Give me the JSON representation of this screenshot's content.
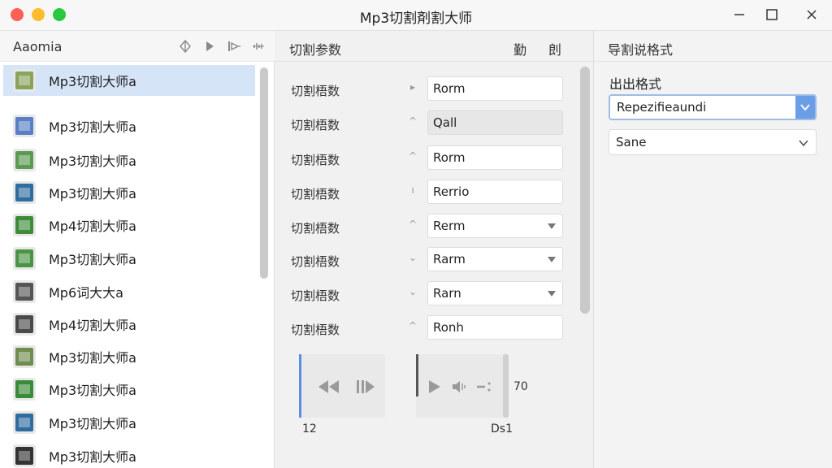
{
  "window": {
    "title": "Mp3切割剤割大师"
  },
  "sidebar": {
    "title": "Aaomia",
    "tools": [
      "diamond-icon",
      "play-icon",
      "skip-icon",
      "waveform-icon"
    ],
    "items": [
      {
        "label": "Mp3切割大师a",
        "icon": "grid-file-icon",
        "color": "#8aa35c",
        "selected": true
      },
      {
        "label": "Mp3切割大师a",
        "icon": "info-file-icon",
        "color": "#5a7fc4"
      },
      {
        "label": "Mp3切割大师a",
        "icon": "lines-file-icon",
        "color": "#5b9a52"
      },
      {
        "label": "Mp3切割大师a",
        "icon": "forward-file-icon",
        "color": "#2f6d9e"
      },
      {
        "label": "Mp4切割大师a",
        "icon": "green-video-icon",
        "color": "#3e8c3a"
      },
      {
        "label": "Mp3切割大师a",
        "icon": "green-screen-icon",
        "color": "#4a9448"
      },
      {
        "label": "Mp6词大大a",
        "icon": "dark-file-icon",
        "color": "#555555"
      },
      {
        "label": "Mp4切割大师a",
        "icon": "close-file-icon",
        "color": "#4a4a4a"
      },
      {
        "label": "Mp3切割大师a",
        "icon": "grid-file-icon",
        "color": "#6f8d4f"
      },
      {
        "label": "Mp3切割大师a",
        "icon": "play-file-icon",
        "color": "#3b8a39"
      },
      {
        "label": "Mp3切割大师a",
        "icon": "blue-file-icon",
        "color": "#2f6d9e"
      },
      {
        "label": "Mp3切割大师a",
        "icon": "stripe-file-icon",
        "color": "#333333"
      }
    ]
  },
  "middle": {
    "title": "切割参数",
    "header_2": "勤",
    "header_3": "剆",
    "params": [
      {
        "label": "切割梧数",
        "arrow": "▸",
        "value": "Rorm",
        "dropdown": false,
        "disabled": false
      },
      {
        "label": "切割梧数",
        "arrow": "^",
        "value": "Qall",
        "dropdown": false,
        "disabled": true
      },
      {
        "label": "切割梧数",
        "arrow": "^",
        "value": "Rorm",
        "dropdown": false,
        "disabled": false
      },
      {
        "label": "切割梧数",
        "arrow": "ı",
        "value": "Rerrio",
        "dropdown": false,
        "disabled": false
      },
      {
        "label": "切割梧数",
        "arrow": "^",
        "value": "Rerm",
        "dropdown": true,
        "disabled": false
      },
      {
        "label": "切割梧数",
        "arrow": "⌄",
        "value": "Rarm",
        "dropdown": true,
        "disabled": false
      },
      {
        "label": "切割梧数",
        "arrow": "⌄",
        "value": "Rarn",
        "dropdown": true,
        "disabled": false
      },
      {
        "label": "切割梧数",
        "arrow": "^",
        "value": "Ronh",
        "dropdown": false,
        "disabled": false
      }
    ],
    "player": {
      "start": "12",
      "end": "Ds1",
      "value": "70"
    }
  },
  "right": {
    "title": "导割说格式",
    "section": "出出格式",
    "select_1": "Repezifieaundi",
    "select_2": "Sane"
  },
  "colors": {
    "accent": "#5b8de0",
    "selection": "#d6e4f7"
  }
}
